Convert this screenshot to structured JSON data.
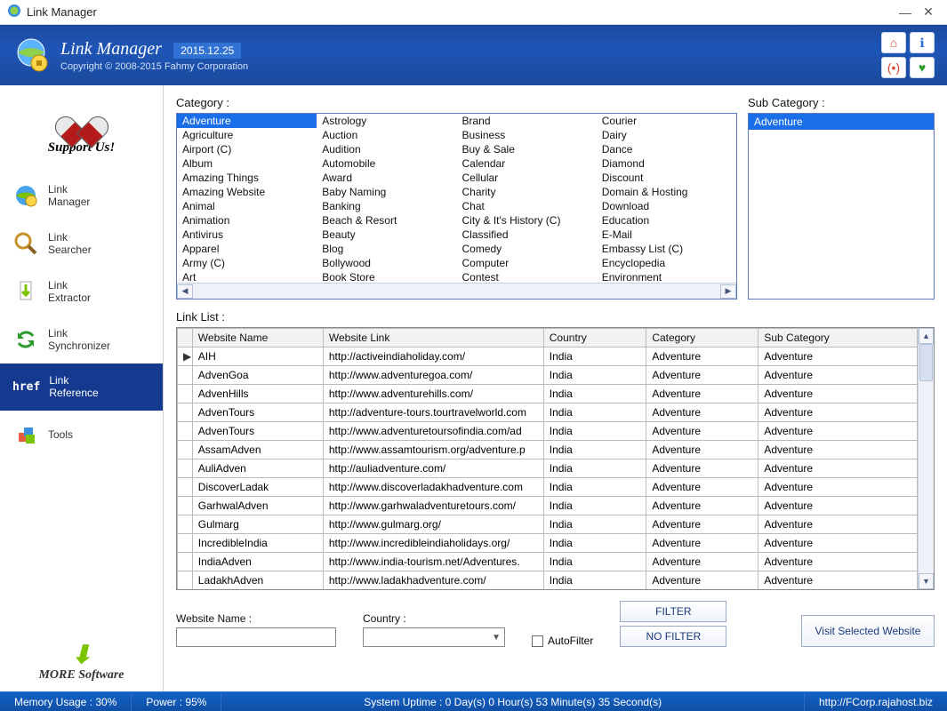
{
  "window": {
    "title": "Link Manager"
  },
  "banner": {
    "title": "Link Manager",
    "version": "2015.12.25",
    "copyright": "Copyright © 2008-2015 Fahmy Corporation"
  },
  "sidebar": {
    "support": "Support Us!",
    "items": [
      {
        "label": "Link\nManager",
        "icon": "globe-gear"
      },
      {
        "label": "Link\nSearcher",
        "icon": "magnifier"
      },
      {
        "label": "Link\nExtractor",
        "icon": "download-arrow"
      },
      {
        "label": "Link\nSynchronizer",
        "icon": "sync-arrows"
      },
      {
        "label": "Link\nReference",
        "icon": "href",
        "active": true
      },
      {
        "label": "Tools",
        "icon": "cubes"
      }
    ],
    "more": "MORE Software"
  },
  "category": {
    "label": "Category :",
    "selected": "Adventure",
    "cols": [
      [
        "Adventure",
        "Agriculture",
        "Airport (C)",
        "Album",
        "Amazing Things",
        "Amazing Website",
        "Animal",
        "Animation",
        "Antivirus",
        "Apparel",
        "Army (C)",
        "Art"
      ],
      [
        "Astrology",
        "Auction",
        "Audition",
        "Automobile",
        "Award",
        "Baby Naming",
        "Banking",
        "Beach & Resort",
        "Beauty",
        "Blog",
        "Bollywood",
        "Book Store"
      ],
      [
        "Brand",
        "Business",
        "Buy & Sale",
        "Calendar",
        "Cellular",
        "Charity",
        "Chat",
        "City & It's History (C)",
        "Classified",
        "Comedy",
        "Computer",
        "Contest"
      ],
      [
        "Courier",
        "Dairy",
        "Dance",
        "Diamond",
        "Discount",
        "Domain & Hosting",
        "Download",
        "Education",
        "E-Mail",
        "Embassy List (C)",
        "Encyclopedia",
        "Environment"
      ]
    ]
  },
  "subcategory": {
    "label": "Sub Category :",
    "items": [
      "Adventure"
    ]
  },
  "linklist": {
    "label": "Link List :",
    "headers": [
      "Website Name",
      "Website Link",
      "Country",
      "Category",
      "Sub Category"
    ],
    "rows": [
      {
        "ind": "▶",
        "name": "AIH",
        "link": "http://activeindiaholiday.com/",
        "country": "India",
        "cat": "Adventure",
        "sub": "Adventure"
      },
      {
        "ind": "",
        "name": "AdvenGoa",
        "link": "http://www.adventuregoa.com/",
        "country": "India",
        "cat": "Adventure",
        "sub": "Adventure"
      },
      {
        "ind": "",
        "name": "AdvenHills",
        "link": "http://www.adventurehills.com/",
        "country": "India",
        "cat": "Adventure",
        "sub": "Adventure"
      },
      {
        "ind": "",
        "name": "AdvenTours",
        "link": "http://adventure-tours.tourtravelworld.com",
        "country": "India",
        "cat": "Adventure",
        "sub": "Adventure"
      },
      {
        "ind": "",
        "name": "AdvenTours",
        "link": "http://www.adventuretoursofindia.com/ad",
        "country": "India",
        "cat": "Adventure",
        "sub": "Adventure"
      },
      {
        "ind": "",
        "name": "AssamAdven",
        "link": "http://www.assamtourism.org/adventure.p",
        "country": "India",
        "cat": "Adventure",
        "sub": "Adventure"
      },
      {
        "ind": "",
        "name": "AuliAdven",
        "link": "http://auliadventure.com/",
        "country": "India",
        "cat": "Adventure",
        "sub": "Adventure"
      },
      {
        "ind": "",
        "name": "DiscoverLadak",
        "link": "http://www.discoverladakhadventure.com",
        "country": "India",
        "cat": "Adventure",
        "sub": "Adventure"
      },
      {
        "ind": "",
        "name": "GarhwalAdven",
        "link": "http://www.garhwaladventuretours.com/",
        "country": "India",
        "cat": "Adventure",
        "sub": "Adventure"
      },
      {
        "ind": "",
        "name": "Gulmarg",
        "link": "http://www.gulmarg.org/",
        "country": "India",
        "cat": "Adventure",
        "sub": "Adventure"
      },
      {
        "ind": "",
        "name": "IncredibleIndia",
        "link": "http://www.incredibleindiaholidays.org/",
        "country": "India",
        "cat": "Adventure",
        "sub": "Adventure"
      },
      {
        "ind": "",
        "name": "IndiaAdven",
        "link": "http://www.india-tourism.net/Adventures.",
        "country": "India",
        "cat": "Adventure",
        "sub": "Adventure"
      },
      {
        "ind": "",
        "name": "LadakhAdven",
        "link": "http://www.ladakhadventure.com/",
        "country": "India",
        "cat": "Adventure",
        "sub": "Adventure"
      }
    ]
  },
  "filter": {
    "websiteNameLabel": "Website Name :",
    "countryLabel": "Country :",
    "autofilter": "AutoFilter",
    "filterBtn": "FILTER",
    "nofilterBtn": "NO FILTER",
    "visitBtn": "Visit Selected Website"
  },
  "status": {
    "memory": "Memory Usage : 30%",
    "power": "Power : 95%",
    "uptime": "System Uptime : 0 Day(s) 0 Hour(s) 53 Minute(s) 35 Second(s)",
    "url": "http://FCorp.rajahost.biz"
  }
}
